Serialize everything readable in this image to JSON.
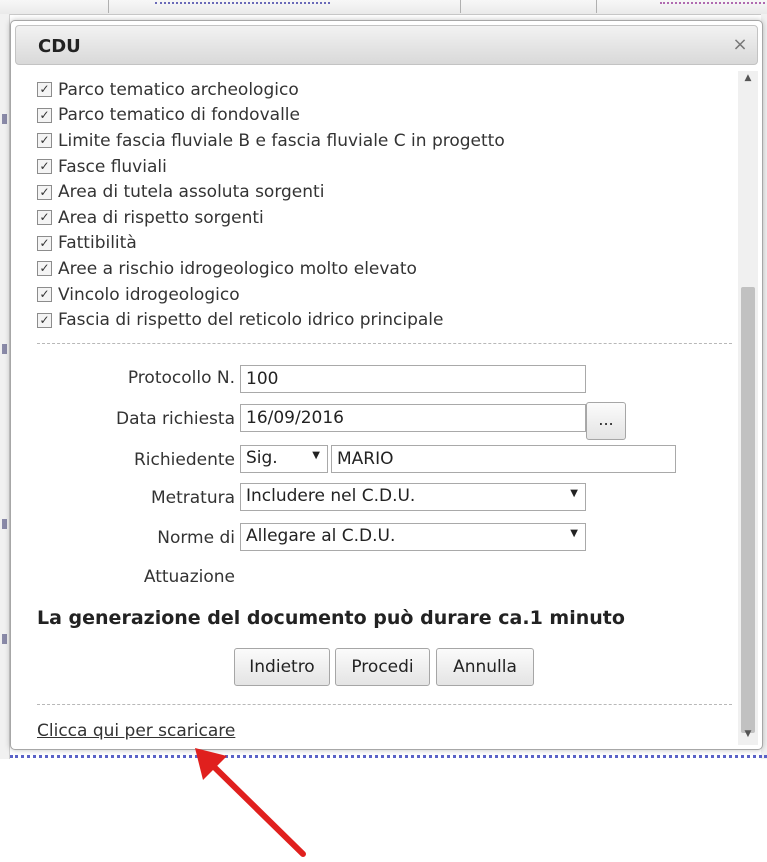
{
  "dialog": {
    "title": "CDU",
    "close_glyph": "×"
  },
  "layers": [
    {
      "label": "Parco tematico archeologico",
      "checked": true
    },
    {
      "label": "Parco tematico di fondovalle",
      "checked": true
    },
    {
      "label": "Limite fascia fluviale B e fascia fluviale C in progetto",
      "checked": true
    },
    {
      "label": "Fasce fluviali",
      "checked": true
    },
    {
      "label": "Area di tutela assoluta sorgenti",
      "checked": true
    },
    {
      "label": "Area di rispetto sorgenti",
      "checked": true
    },
    {
      "label": "Fattibilità",
      "checked": true
    },
    {
      "label": "Aree a rischio idrogeologico molto elevato",
      "checked": true
    },
    {
      "label": "Vincolo idrogeologico",
      "checked": true
    },
    {
      "label": "Fascia di rispetto del reticolo idrico principale",
      "checked": true
    }
  ],
  "form": {
    "protocollo_label": "Protocollo N.",
    "protocollo_value": "100",
    "data_label": "Data richiesta",
    "data_value": "16/09/2016",
    "data_picker_label": "...",
    "richiedente_label": "Richiedente",
    "title_select": "Sig.",
    "richiedente_value": "MARIO",
    "metratura_label": "Metratura",
    "metratura_value": "Includere nel C.D.U.",
    "norme_label": "Norme di",
    "norme_label2": "Attuazione",
    "norme_value": "Allegare al C.D.U."
  },
  "note": "La generazione del documento può durare ca.1 minuto",
  "buttons": {
    "back": "Indietro",
    "proceed": "Procedi",
    "cancel": "Annulla"
  },
  "download_link": "Clicca qui per scaricare",
  "colors": {
    "arrow": "#e0201e",
    "map_line": "#5a62c8"
  },
  "icons": {
    "checkbox": "checkmark-icon",
    "scroll_up": "triangle-up-icon",
    "scroll_down": "triangle-down-icon",
    "select_arrow": "triangle-down-icon",
    "annotation": "red-arrow-icon"
  }
}
